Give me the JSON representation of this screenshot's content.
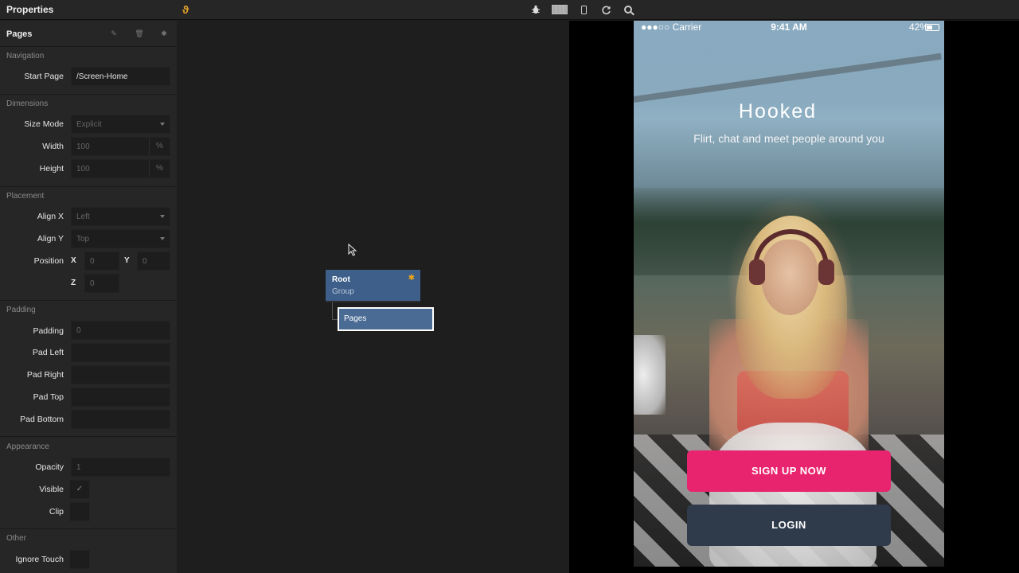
{
  "topbar": {
    "title": "Properties",
    "logo_glyph": "ϑ",
    "icons": [
      "bug-icon",
      "columns-icon",
      "phone-icon",
      "refresh-icon",
      "search-icon"
    ]
  },
  "props": {
    "header": "Pages",
    "header_icons": [
      "edit-icon",
      "trash-icon",
      "settings-icon"
    ],
    "navigation": {
      "label": "Navigation",
      "start_page_label": "Start Page",
      "start_page_value": "/Screen-Home"
    },
    "dimensions": {
      "label": "Dimensions",
      "size_mode_label": "Size Mode",
      "size_mode_value": "Explicit",
      "width_label": "Width",
      "width_value": "100",
      "width_unit": "%",
      "height_label": "Height",
      "height_value": "100",
      "height_unit": "%"
    },
    "placement": {
      "label": "Placement",
      "align_x_label": "Align X",
      "align_x_value": "Left",
      "align_y_label": "Align Y",
      "align_y_value": "Top",
      "position_label": "Position",
      "x_label": "X",
      "x_value": "0",
      "y_label": "Y",
      "y_value": "0",
      "z_label": "Z",
      "z_value": "0"
    },
    "padding": {
      "label": "Padding",
      "padding_label": "Padding",
      "padding_value": "0",
      "pad_left_label": "Pad Left",
      "pad_right_label": "Pad Right",
      "pad_top_label": "Pad Top",
      "pad_bottom_label": "Pad Bottom"
    },
    "appearance": {
      "label": "Appearance",
      "opacity_label": "Opacity",
      "opacity_value": "1",
      "visible_label": "Visible",
      "visible_check": "✓",
      "clip_label": "Clip"
    },
    "other": {
      "label": "Other",
      "ignore_touch_label": "Ignore Touch"
    }
  },
  "graph": {
    "root_title": "Root",
    "root_subtitle": "Group",
    "pages_title": "Pages"
  },
  "preview": {
    "status_left": "●●●○○ Carrier",
    "status_time": "9:41 AM",
    "status_battery": "42%",
    "app_title": "Hooked",
    "app_subtitle": "Flirt, chat and meet people around you",
    "signup_label": "SIGN UP NOW",
    "login_label": "LOGIN",
    "colors": {
      "signup": "#e8246f",
      "login": "#2f3a4b"
    }
  }
}
